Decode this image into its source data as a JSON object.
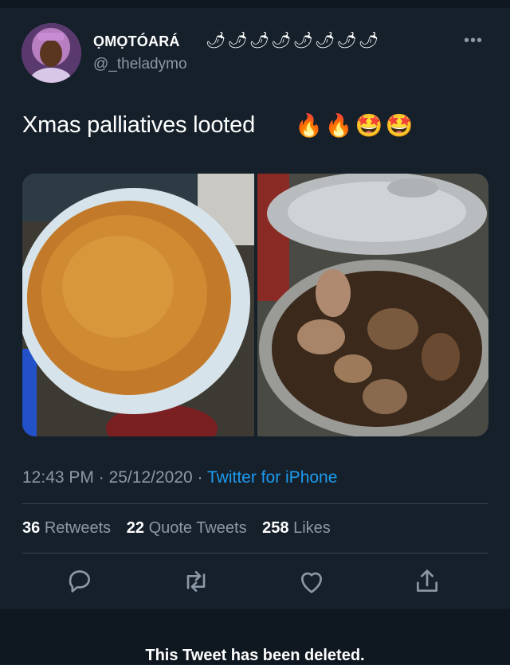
{
  "author": {
    "display_name": "ỌMỌTÓARÁ",
    "name_emojis": "🌶🌶🌶🌶🌶🌶🌶🌶",
    "handle": "@_theladymo"
  },
  "tweet": {
    "text": "Xmas palliatives looted",
    "text_emojis": "🔥🔥🤩🤩",
    "time": "12:43 PM",
    "date": "25/12/2020",
    "source": "Twitter for iPhone"
  },
  "stats": {
    "retweets_count": "36",
    "retweets_label": "Retweets",
    "quotes_count": "22",
    "quotes_label": "Quote Tweets",
    "likes_count": "258",
    "likes_label": "Likes"
  },
  "more_label": "•••",
  "separator": "·",
  "notice": "This Tweet has been deleted.",
  "icons": [
    "reply-icon",
    "retweet-icon",
    "like-icon",
    "share-icon",
    "more-icon"
  ],
  "colors": {
    "background": "#15202b",
    "accent": "#1d9bf0",
    "muted": "#8b98a5",
    "divider": "#38444d"
  }
}
